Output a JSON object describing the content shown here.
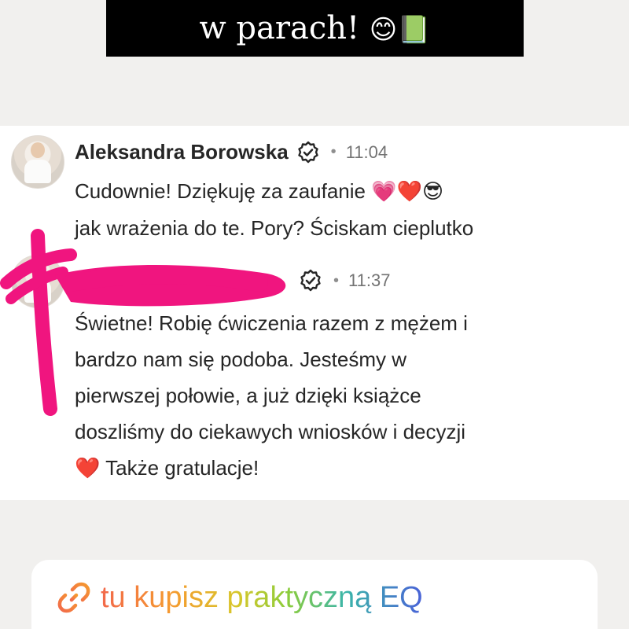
{
  "caption": {
    "text": "w parach!",
    "emojis": "😊📗"
  },
  "comments": [
    {
      "author": "Aleksandra Borowska",
      "time": "11:04",
      "lines": [
        "Cudownie! Dziękuję za zaufanie",
        "jak wrażenia do te. Pory? Ściskam cieplutko"
      ],
      "line1_emojis": "💗❤️😎"
    },
    {
      "author": "",
      "time": "11:37",
      "lines": [
        "Świetne! Robię ćwiczenia razem z mężem i",
        "bardzo nam się podoba. Jesteśmy w",
        "pierwszej połowie, a już dzięki książce",
        "doszliśmy do ciekawych wniosków i decyzji",
        "Także gratulacje!"
      ],
      "line5_emoji": "❤️"
    }
  ],
  "link_sticker": {
    "text": "tu kupisz praktyczną EQ"
  },
  "colors": {
    "scribble": "#f0157f",
    "verified_badge": "#262626"
  }
}
